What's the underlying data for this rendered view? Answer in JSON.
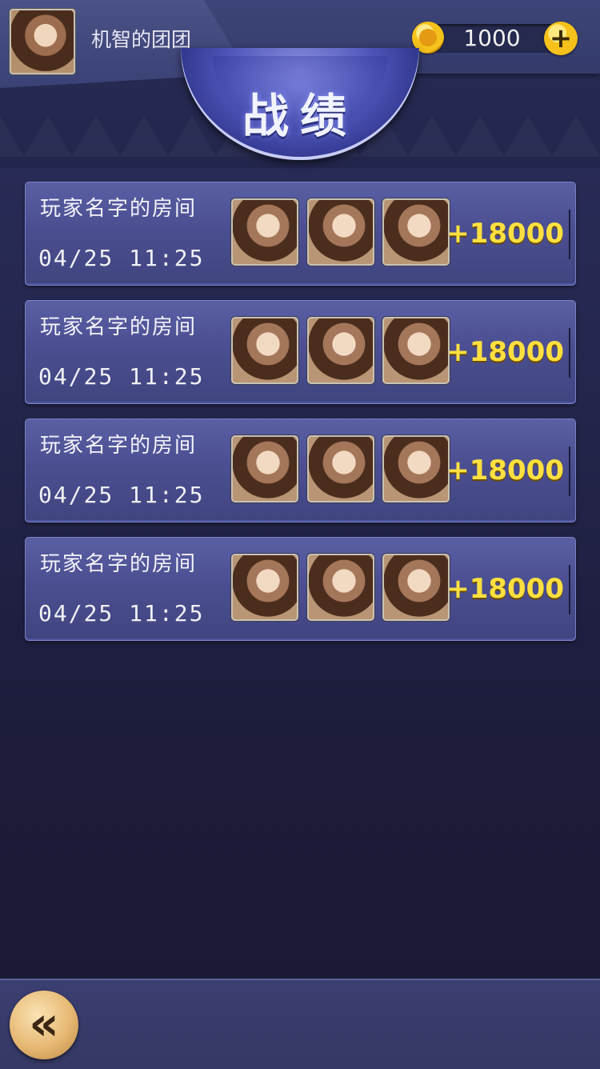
{
  "header": {
    "username": "机智的团团",
    "coins": "1000",
    "add_label": "+"
  },
  "title": "战绩",
  "records": [
    {
      "room": "玩家名字的房间",
      "time": "04/25  11:25",
      "score": "+18000"
    },
    {
      "room": "玩家名字的房间",
      "time": "04/25  11:25",
      "score": "+18000"
    },
    {
      "room": "玩家名字的房间",
      "time": "04/25  11:25",
      "score": "+18000"
    },
    {
      "room": "玩家名字的房间",
      "time": "04/25  11:25",
      "score": "+18000"
    }
  ],
  "footer": {
    "back_label": "«"
  },
  "colors": {
    "score": "#ffe040",
    "accent": "#f5c21b"
  }
}
